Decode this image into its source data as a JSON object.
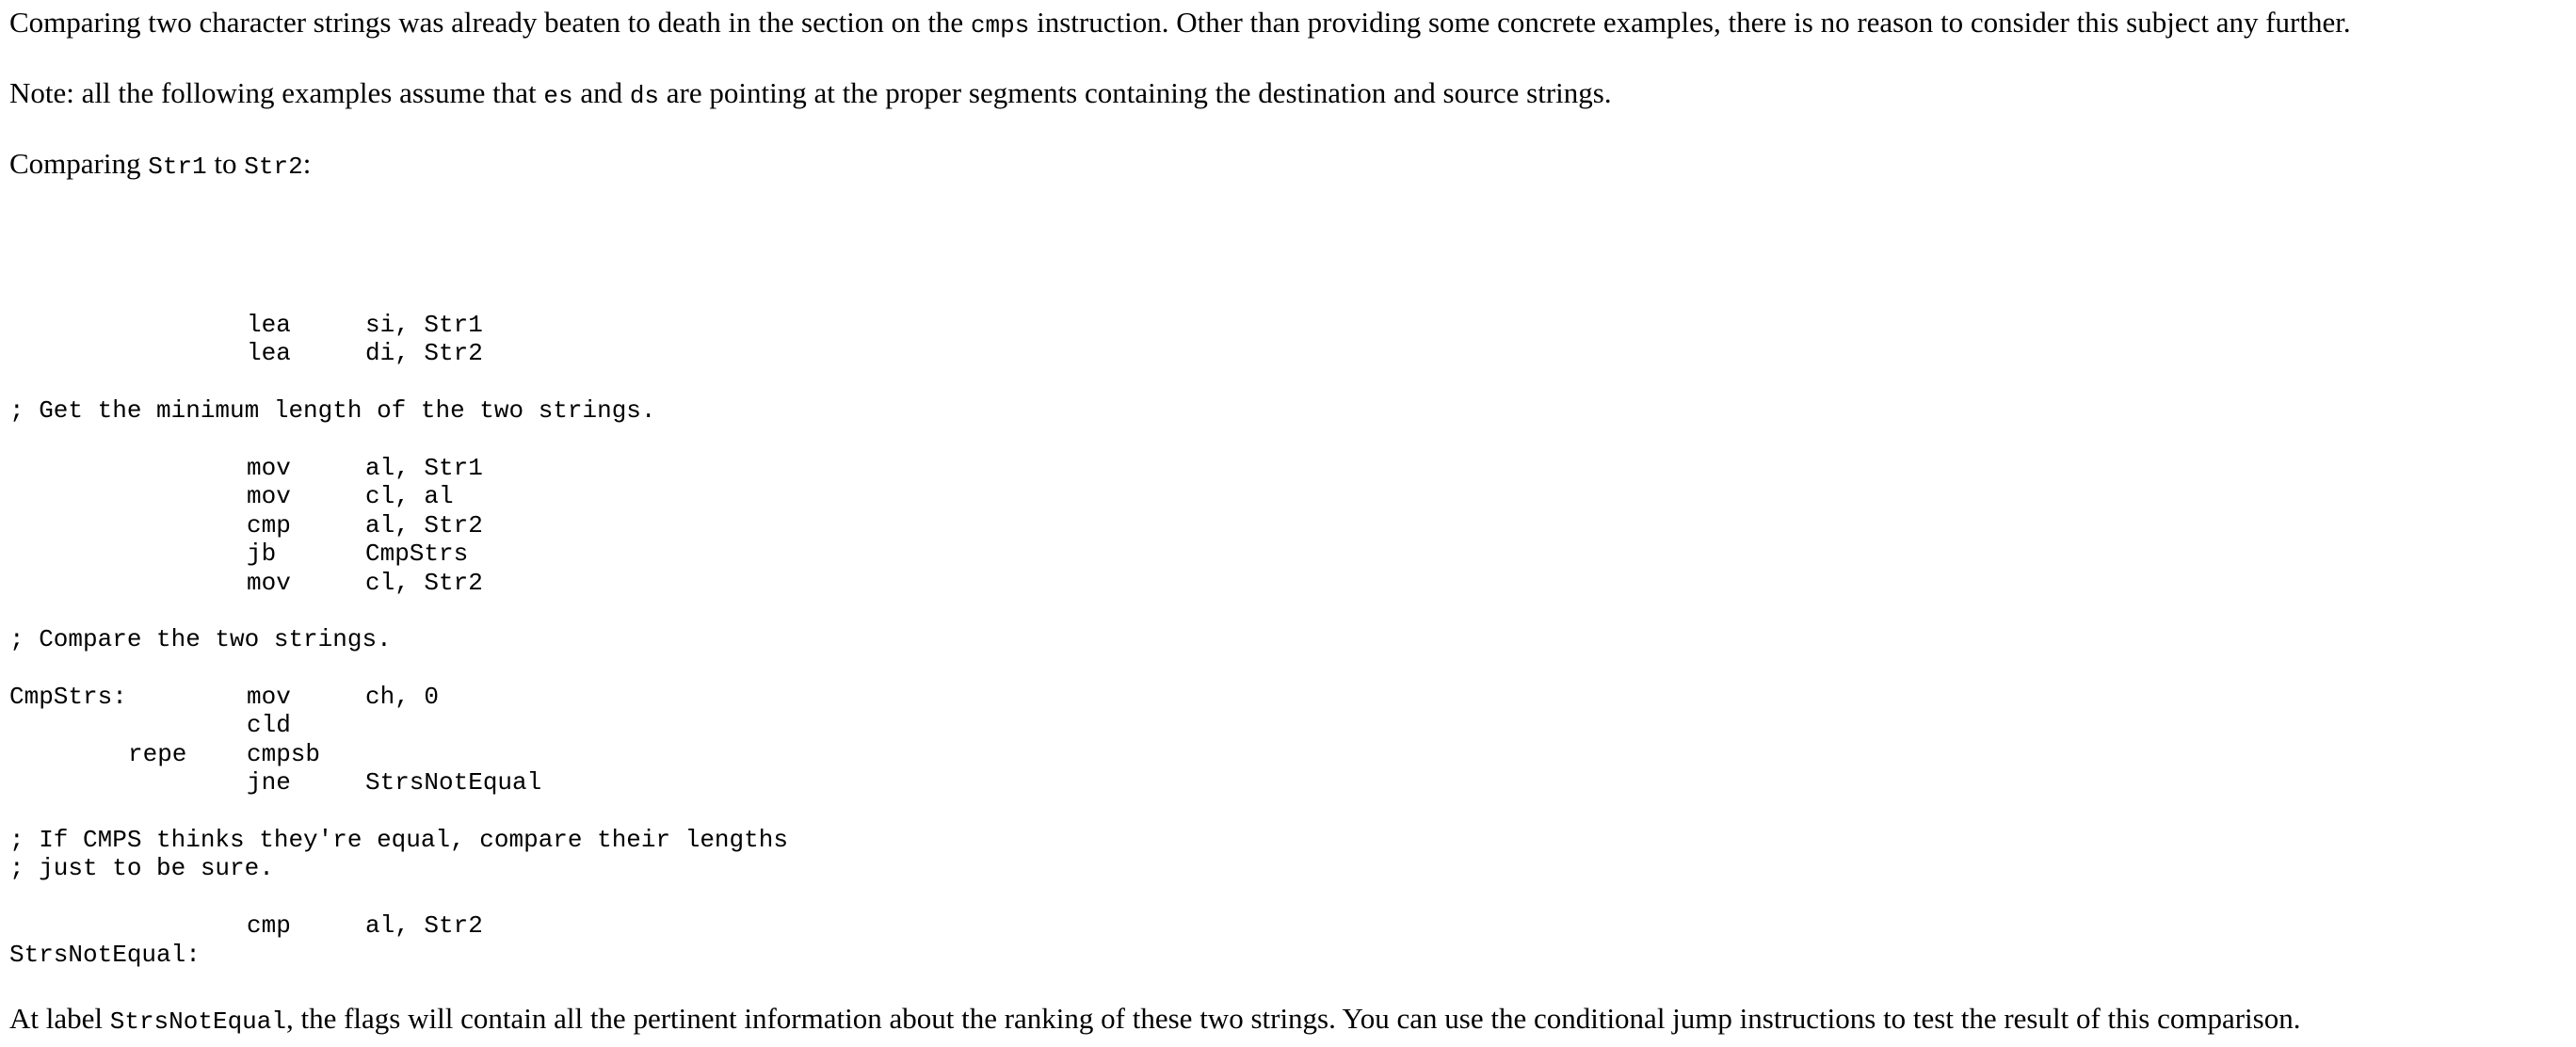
{
  "intro": {
    "p1_before": "Comparing two character strings was already beaten to death in the section on the ",
    "p1_code": "cmps",
    "p1_after": " instruction. Other than providing some concrete examples, there is no reason to consider this subject any further.",
    "p2_before": "Note: all the following examples assume that ",
    "p2_code1": "es",
    "p2_mid": " and ",
    "p2_code2": "ds",
    "p2_after": " are pointing at the proper segments containing the destination and source strings.",
    "p3_before": "Comparing ",
    "p3_code1": "Str1",
    "p3_mid": " to ",
    "p3_code2": "Str2",
    "p3_after": ":"
  },
  "listing": [
    {
      "label": "",
      "prefix": "",
      "op": "lea",
      "args": "si, Str1"
    },
    {
      "label": "",
      "prefix": "",
      "op": "lea",
      "args": "di, Str2"
    },
    {
      "blank": true
    },
    {
      "comment": "; Get the minimum length of the two strings."
    },
    {
      "blank": true
    },
    {
      "label": "",
      "prefix": "",
      "op": "mov",
      "args": "al, Str1"
    },
    {
      "label": "",
      "prefix": "",
      "op": "mov",
      "args": "cl, al"
    },
    {
      "label": "",
      "prefix": "",
      "op": "cmp",
      "args": "al, Str2"
    },
    {
      "label": "",
      "prefix": "",
      "op": "jb",
      "args": "CmpStrs"
    },
    {
      "label": "",
      "prefix": "",
      "op": "mov",
      "args": "cl, Str2"
    },
    {
      "blank": true
    },
    {
      "comment": "; Compare the two strings."
    },
    {
      "blank": true
    },
    {
      "label": "CmpStrs:",
      "prefix": "",
      "op": "mov",
      "args": "ch, 0"
    },
    {
      "label": "",
      "prefix": "",
      "op": "cld",
      "args": ""
    },
    {
      "label": "",
      "prefix": "repe",
      "op": "cmpsb",
      "args": ""
    },
    {
      "label": "",
      "prefix": "",
      "op": "jne",
      "args": "StrsNotEqual"
    },
    {
      "blank": true
    },
    {
      "comment": "; If CMPS thinks they're equal, compare their lengths"
    },
    {
      "comment": "; just to be sure."
    },
    {
      "blank": true
    },
    {
      "label": "",
      "prefix": "",
      "op": "cmp",
      "args": "al, Str2"
    },
    {
      "label": "StrsNotEqual:",
      "prefix": "",
      "op": "",
      "args": ""
    }
  ],
  "outro": {
    "p4_before": "At label ",
    "p4_code": "StrsNotEqual",
    "p4_after": ", the flags will contain all the pertinent information about the ranking of these two strings. You can use the conditional jump instructions to test the result of this comparison."
  }
}
